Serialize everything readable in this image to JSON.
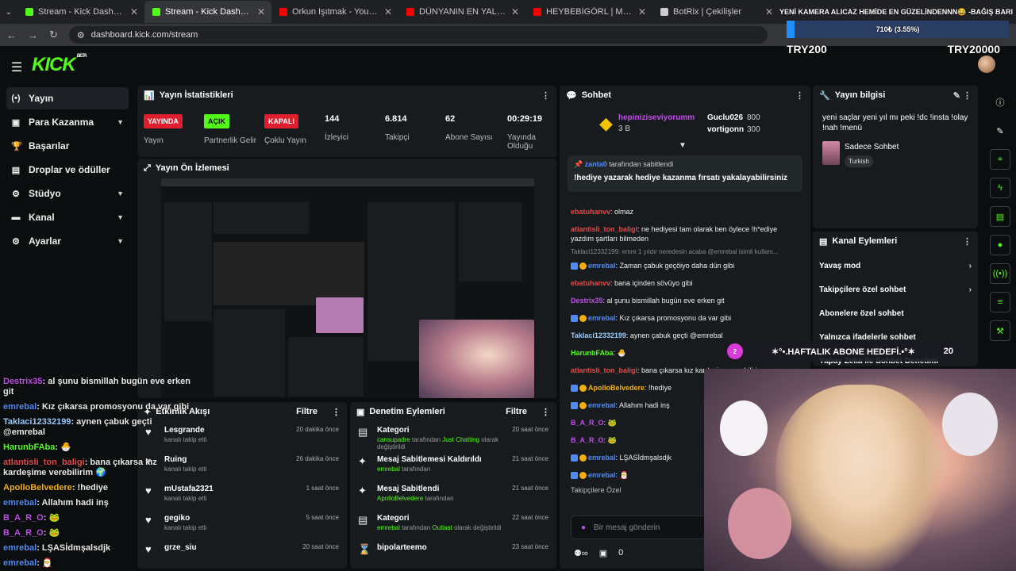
{
  "browser": {
    "tabs": [
      {
        "title": "Stream - Kick Dashboard",
        "color": "#53fc18"
      },
      {
        "title": "Stream - Kick Dashboard",
        "color": "#53fc18"
      },
      {
        "title": "Orkun Işıtmak - YouTube",
        "color": "#ff0000"
      },
      {
        "title": "DÜNYANIN EN YALNIZ EVİNDE",
        "color": "#ff0000"
      },
      {
        "title": "HEYBEBİGÖRL | Madara Olduk",
        "color": "#ff0000"
      },
      {
        "title": "BotRix | Çekilişler",
        "color": "#cccccc"
      }
    ],
    "url": "dashboard.kick.com/stream"
  },
  "top_goal": {
    "title": "YENİ KAMERA ALICAZ HEMİDE EN GÜZELİNDENNN😂 -BAĞIŞ BARI",
    "progress_text": "710₺ (3.55%)",
    "progress_fraction": 0.0355,
    "min_label": "TRY200",
    "max_label": "TRY20000"
  },
  "brand": {
    "logo": "KICK",
    "beta": "BETA"
  },
  "sidebar": [
    {
      "label": "Yayın",
      "icon": "(•)",
      "chevron": ""
    },
    {
      "label": "Para Kazanma",
      "icon": "▣",
      "chevron": "▼"
    },
    {
      "label": "Başarılar",
      "icon": "🏆",
      "chevron": ""
    },
    {
      "label": "Droplar ve ödüller",
      "icon": "▤",
      "chevron": ""
    },
    {
      "label": "Stüdyo",
      "icon": "⚙",
      "chevron": "▼"
    },
    {
      "label": "Kanal",
      "icon": "▬",
      "chevron": "▼"
    },
    {
      "label": "Ayarlar",
      "icon": "⚙",
      "chevron": "▼"
    }
  ],
  "stats": {
    "title": "Yayın İstatistikleri",
    "items": [
      {
        "badge": "YAYINDA",
        "label": "Yayın"
      },
      {
        "badge": "AÇIK",
        "label": "Partnerlik Gelir"
      },
      {
        "badge": "KAPALI",
        "label": "Çoklu Yayın"
      },
      {
        "value": "144",
        "label": "İzleyici"
      },
      {
        "value": "6.814",
        "label": "Takipçi"
      },
      {
        "value": "62",
        "label": "Abone Sayısı"
      },
      {
        "value": "00:29:19",
        "label": "Yayında Olduğu"
      }
    ]
  },
  "preview": {
    "title": "Yayın Ön İzlemesi"
  },
  "events": {
    "title": "Etkinlik Akışı",
    "filter": "Filtre",
    "rows": [
      {
        "name": "Lesgrande",
        "sub": "kanalı takip etti",
        "time": "20 dakika önce"
      },
      {
        "name": "Ruing",
        "sub": "kanalı takip etti",
        "time": "26 dakika önce"
      },
      {
        "name": "mUstafa2321",
        "sub": "kanalı takip etti",
        "time": "1 saat önce"
      },
      {
        "name": "gegiko",
        "sub": "kanalı takip etti",
        "time": "5 saat önce"
      },
      {
        "name": "grze_siu",
        "sub": "",
        "time": "20 saat önce"
      }
    ]
  },
  "moderation": {
    "title": "Denetim Eylemleri",
    "filter": "Filtre",
    "rows": [
      {
        "icon": "▤",
        "name": "Kategori",
        "user": "cansupadre",
        "mid": " tarafından ",
        "target": "Just Chatting",
        "tail": " olarak değiştirildi",
        "time": "20 saat önce"
      },
      {
        "icon": "✦",
        "name": "Mesaj Sabitlemesi Kaldırıldı",
        "user": "emrebal",
        "mid": " tarafından",
        "target": "",
        "tail": "",
        "time": "21 saat önce"
      },
      {
        "icon": "✦",
        "name": "Mesaj Sabitlendi",
        "user": "ApolloBelvedere",
        "mid": " tarafından",
        "target": "",
        "tail": "",
        "time": "21 saat önce"
      },
      {
        "icon": "▤",
        "name": "Kategori",
        "user": "emrebal",
        "mid": " tarafından ",
        "target": "Outlast",
        "tail": " olarak değiştirildi",
        "time": "22 saat önce"
      },
      {
        "icon": "⌛",
        "name": "bipolarteemo",
        "user": "",
        "mid": "",
        "target": "",
        "tail": "",
        "time": "23 saat önce"
      }
    ]
  },
  "chat": {
    "title": "Sohbet",
    "gifter_top": "hepiniziseviyorumm",
    "gifter_top_amount": "3 B",
    "gifter_2": "Guclu026",
    "gifter_2_amount": "800",
    "gifter_3": "vortigonn",
    "gifter_3_amount": "300",
    "pinned_by_user": "zanta0",
    "pinned_by_text": " tarafından sabitlendi",
    "pinned_message": "!hediye yazarak hediye kazanma fırsatı yakalayabilirsiniz",
    "messages": [
      {
        "user": "ebatuhanvv",
        "text": ": olmaz",
        "cls": "u2"
      },
      {
        "user": "atlantisli_ton_baligi",
        "text": ": ne hediyesi tam olarak ben öylece !h*ediye yazdım şartları bilmeden",
        "cls": "u2"
      },
      {
        "user": "emrebal",
        "text": ": Zaman çabuk geçöiyo daha dün gibi",
        "cls": "u3"
      },
      {
        "user": "ebatuhanvv",
        "text": ": bana içinden sövüyo gibi",
        "cls": "u2"
      },
      {
        "user": "Destrix35",
        "text": ": al şunu bismillah bugün eve erken git",
        "cls": "u1"
      },
      {
        "user": "emrebal",
        "text": ": Kız çıkarsa promosyonu da var gibi",
        "cls": "u3"
      },
      {
        "user": "Taklaci12332199",
        "text": ": aynen çabuk geçti @emrebal",
        "cls": "u6"
      },
      {
        "user": "HarunbFAba",
        "text": ": 🐣",
        "cls": "u4"
      },
      {
        "user": "atlantisli_ton_baligi",
        "text": ": bana çıkarsa kız kardeşime verebilirim",
        "cls": "u2"
      },
      {
        "user": "ApolloBelvedere",
        "text": ": !hediye",
        "cls": "u5"
      },
      {
        "user": "emrebal",
        "text": ": Allahım hadi inş",
        "cls": "u3"
      },
      {
        "user": "B_A_R_O",
        "text": ": 🐸",
        "cls": "u1"
      },
      {
        "user": "B_A_R_O",
        "text": ": 🐸",
        "cls": "u1"
      },
      {
        "user": "emrebal",
        "text": ": LŞASİdmşalsdjk",
        "cls": "u3"
      },
      {
        "user": "emrebal",
        "text": ": 🎅",
        "cls": "u3"
      }
    ],
    "reply_hint": "Taklaci12332199: emre 1 yıldır neredesin acaba @emrebal isimli kullanı...",
    "followers_only": "Takipçilere Özel",
    "input_placeholder": "Bir mesaj gönderin",
    "points": "0"
  },
  "stream_info": {
    "title": "Yayın bilgisi",
    "stream_title": "yeni saçlar yeni yıl mı peki !dc !insta !olay !nah !menü",
    "category": "Sadece Sohbet",
    "tag": "Turkish"
  },
  "channel_actions": {
    "title": "Kanal Eylemleri",
    "rows": [
      {
        "label": "Yavaş mod",
        "action": "›"
      },
      {
        "label": "Takipçilere özel sohbet",
        "action": "›"
      },
      {
        "label": "Abonelere özel sohbet",
        "action": ""
      },
      {
        "label": "Yalnızca ifadelerle sohbet",
        "action": ""
      },
      {
        "label": "Yapay Zeka ile Sohbet Denetimi",
        "action": ""
      }
    ]
  },
  "sub_goal": {
    "num": "2",
    "title": "✶°•.HAFTALIK ABONE HEDEFİ.•°✶",
    "target": "20"
  },
  "overlay_chat": [
    {
      "user": "Destrix35",
      "text": ": al şunu bismillah bugün eve erken git",
      "cls": "u1"
    },
    {
      "user": "emrebal",
      "text": ": Kız çıkarsa promosyonu da var gibi",
      "cls": "u3"
    },
    {
      "user": "Taklaci12332199",
      "text": ": aynen çabuk geçti @emrebal",
      "cls": "u6"
    },
    {
      "user": "HarunbFAba",
      "text": ": 🐣",
      "cls": "u4"
    },
    {
      "user": "atlantisli_ton_baligi",
      "text": ": bana çıkarsa kız kardeşime verebilirim 🌍",
      "cls": "u2"
    },
    {
      "user": "ApolloBelvedere",
      "text": ": !hediye",
      "cls": "u5"
    },
    {
      "user": "emrebal",
      "text": ": Allahım hadi inş",
      "cls": "u3"
    },
    {
      "user": "B_A_R_O",
      "text": ": 🐸",
      "cls": "u1"
    },
    {
      "user": "B_A_R_O",
      "text": ": 🐸",
      "cls": "u1"
    },
    {
      "user": "emrebal",
      "text": ": LŞASİdmşalsdjk",
      "cls": "u3"
    },
    {
      "user": "emrebal",
      "text": ": 🎅",
      "cls": "u3"
    }
  ]
}
